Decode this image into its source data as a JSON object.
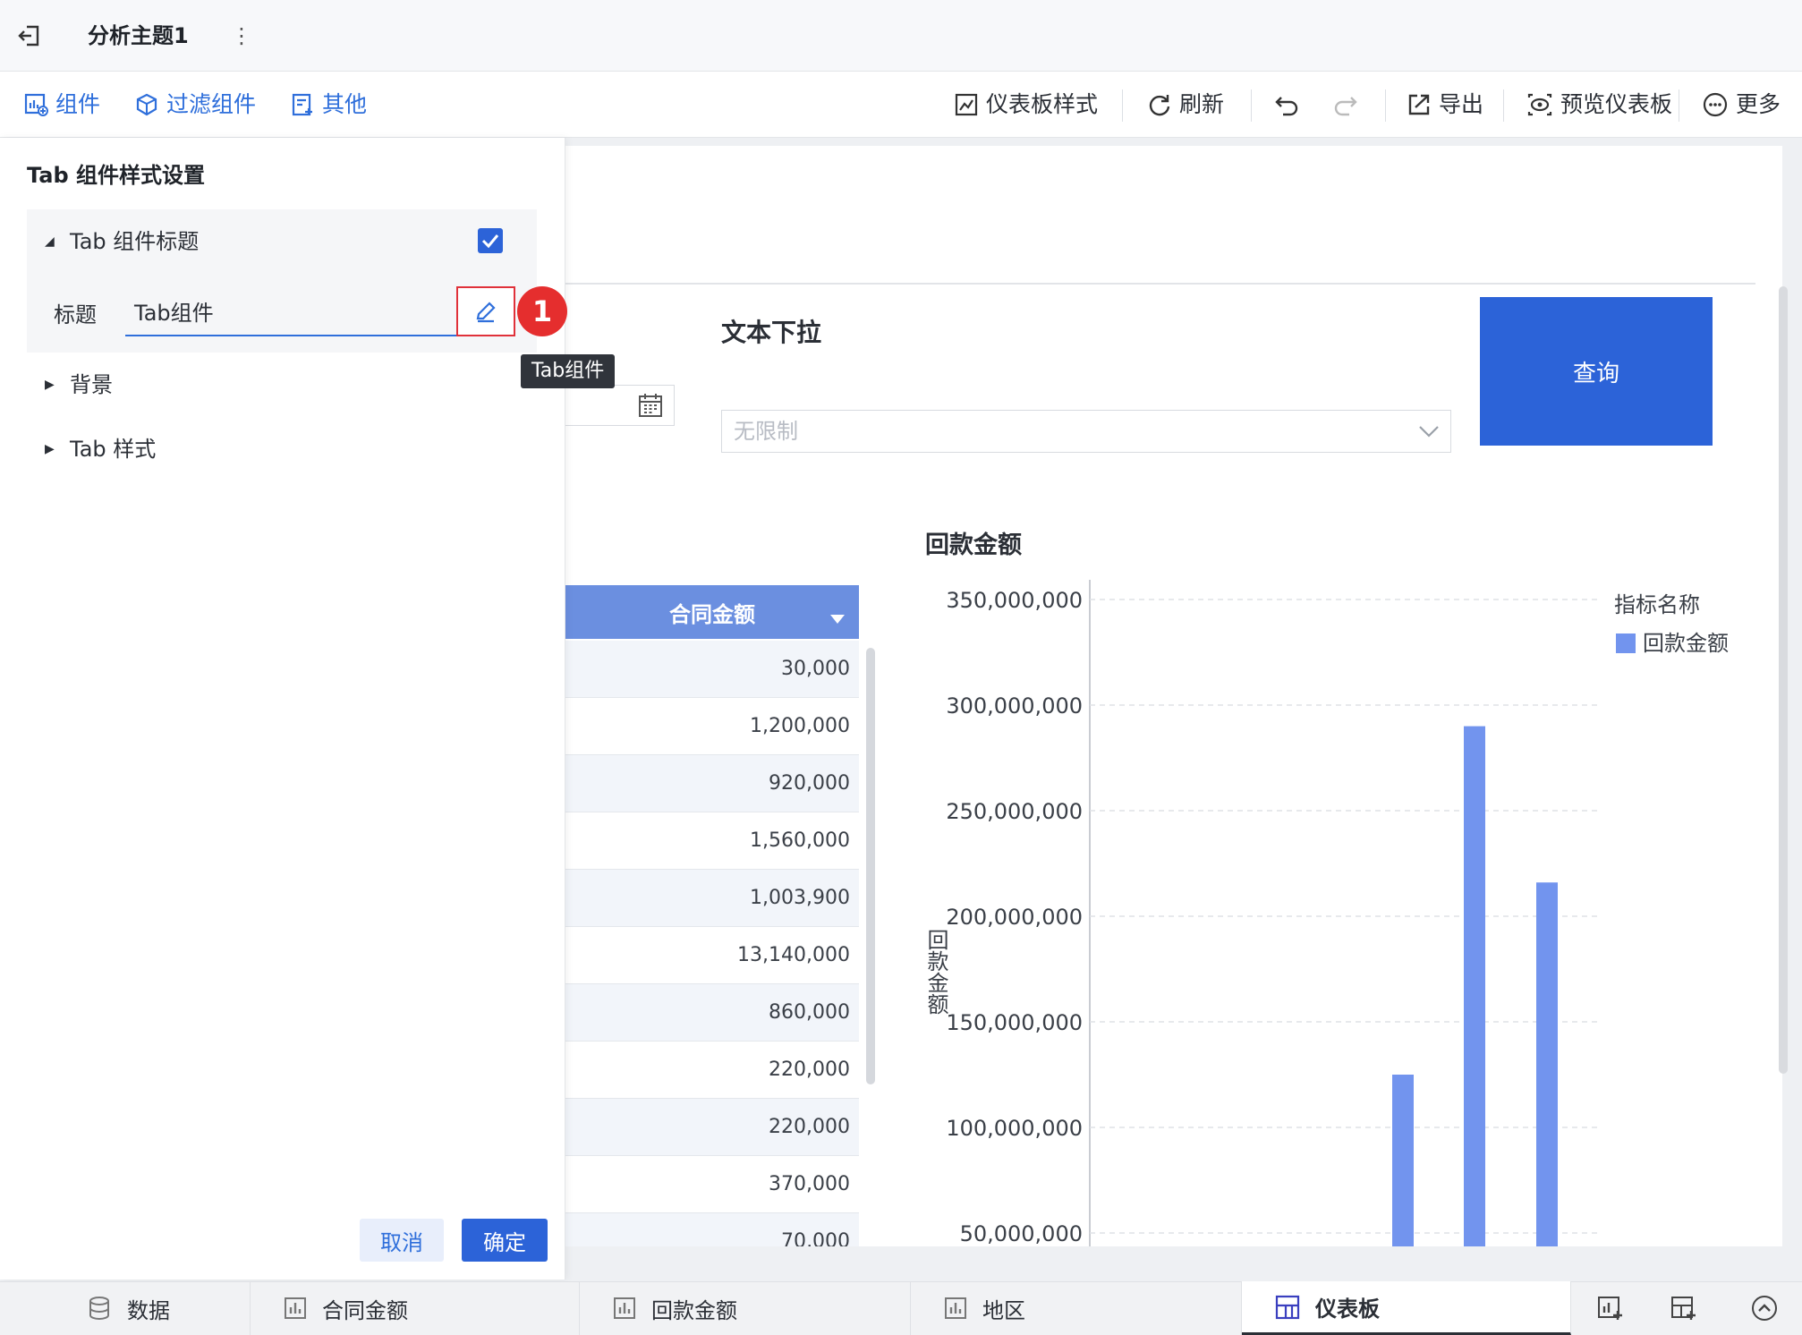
{
  "topbar": {
    "title": "分析主题1",
    "more_glyph": "⋮"
  },
  "toolbar": {
    "left": [
      {
        "label": "组件",
        "icon": "add-chart-icon"
      },
      {
        "label": "过滤组件",
        "icon": "filter-cube-icon"
      },
      {
        "label": "其他",
        "icon": "add-doc-icon"
      }
    ],
    "right": [
      {
        "label": "仪表板样式",
        "icon": "style-icon"
      },
      {
        "label": "刷新",
        "icon": "refresh-icon"
      },
      {
        "label": "导出",
        "icon": "export-icon"
      },
      {
        "label": "预览仪表板",
        "icon": "preview-icon"
      },
      {
        "label": "更多",
        "icon": "more-circle-icon"
      }
    ]
  },
  "panel": {
    "title": "Tab 组件样式设置",
    "section_title": "Tab 组件标题",
    "title_label": "标题",
    "title_value": "Tab组件",
    "section_background": "背景",
    "section_tab_style": "Tab 样式",
    "badge": "1",
    "tooltip": "Tab组件",
    "cancel": "取消",
    "confirm": "确定"
  },
  "canvas": {
    "dropdown_label": "文本下拉",
    "dropdown_value": "无限制",
    "query_button": "查询"
  },
  "table": {
    "header": "合同金额",
    "rows": [
      "30,000",
      "1,200,000",
      "920,000",
      "1,560,000",
      "1,003,900",
      "13,140,000",
      "860,000",
      "220,000",
      "220,000",
      "370,000",
      "70,000"
    ]
  },
  "chart_data": {
    "type": "bar",
    "title": "回款金额",
    "ylabel": "回款金额",
    "legend_title": "指标名称",
    "legend_position": "top-right",
    "ylim": [
      0,
      350000000
    ],
    "ticks": [
      "350,000,000",
      "300,000,000",
      "250,000,000",
      "200,000,000",
      "150,000,000",
      "100,000,000",
      "50,000,000"
    ],
    "tick_values": [
      350000000,
      300000000,
      250000000,
      200000000,
      150000000,
      100000000,
      50000000
    ],
    "series": [
      {
        "name": "回款金额",
        "values": [
          125000000,
          290000000,
          216000000
        ],
        "color": "#7294ee"
      }
    ]
  },
  "bottom_tabs": [
    {
      "label": "数据",
      "icon": "database-icon"
    },
    {
      "label": "合同金额",
      "icon": "bar-chart-icon"
    },
    {
      "label": "回款金额",
      "icon": "bar-chart-icon"
    },
    {
      "label": "地区",
      "icon": "bar-chart-icon"
    },
    {
      "label": "仪表板",
      "icon": "dashboard-icon",
      "active": true
    }
  ],
  "colors": {
    "accent": "#2c63d8",
    "link": "#2f6fdb",
    "bar": "#7294ee",
    "table_header": "#6b8fe0",
    "badge": "#e52e2e"
  }
}
